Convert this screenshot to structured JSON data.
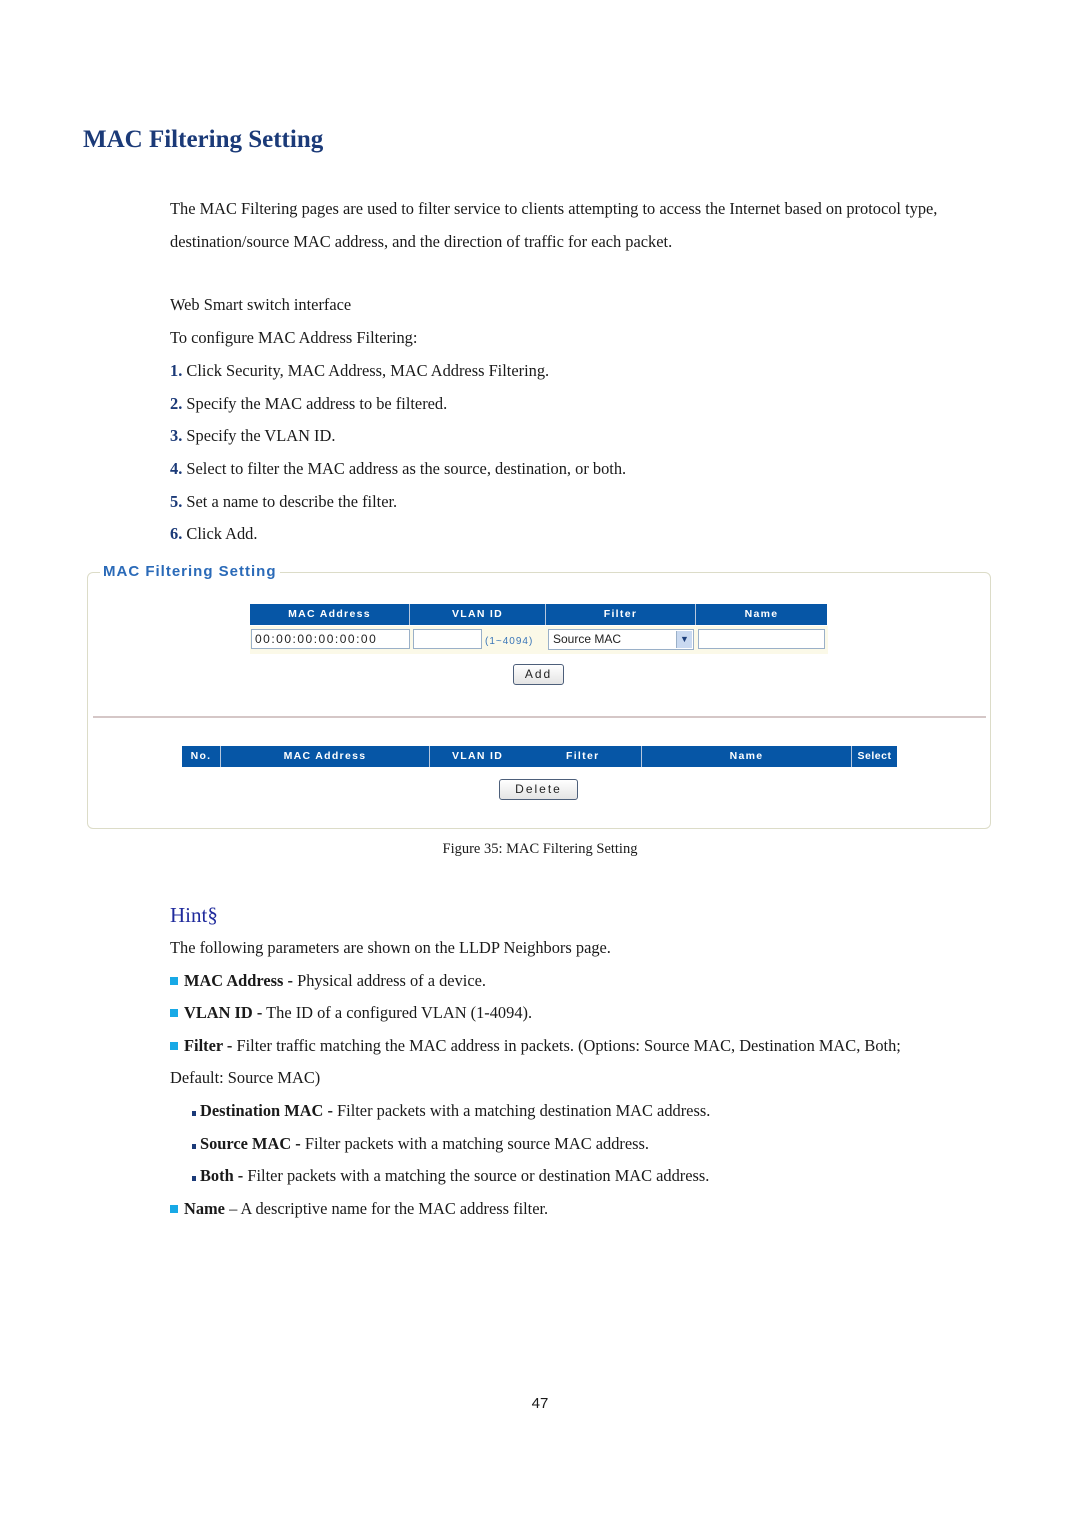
{
  "document": {
    "title": "MAC Filtering Setting",
    "intro": "The MAC Filtering pages are used to filter service to clients attempting to access the Internet based on protocol type, destination/source MAC address, and the direction of traffic for each packet.",
    "interface_label": "Web Smart switch interface",
    "configure_label": "To configure MAC Address Filtering:",
    "steps": [
      {
        "num": "1.",
        "text": "Click Security, MAC Address, MAC Address Filtering."
      },
      {
        "num": "2.",
        "text": "Specify the MAC address to be filtered."
      },
      {
        "num": "3.",
        "text": "Specify the VLAN ID."
      },
      {
        "num": "4.",
        "text": "Select to filter the MAC address as the source, destination, or both."
      },
      {
        "num": "5.",
        "text": "Set a name to describe the filter."
      },
      {
        "num": "6.",
        "text": "Click Add."
      }
    ],
    "figure_caption": "Figure 35: MAC Filtering Setting",
    "hint_heading": "Hint§",
    "hint_intro": "The following parameters are shown on the LLDP Neighbors page.",
    "params": [
      {
        "term": "MAC Address -",
        "desc": " Physical address of a device."
      },
      {
        "term": "VLAN ID -",
        "desc": " The ID of a configured VLAN (1-4094)."
      },
      {
        "term": "Filter -",
        "desc": " Filter traffic matching the MAC address in packets. (Options: Source MAC, Destination MAC, Both;",
        "desc_cont": "Default: Source MAC)"
      },
      {
        "term": "Name",
        "desc": " – A descriptive name for the MAC address filter."
      }
    ],
    "sub_params": [
      {
        "term": "Destination MAC -",
        "desc": " Filter packets with a matching destination MAC address."
      },
      {
        "term": "Source MAC -",
        "desc": " Filter packets with a matching source MAC address."
      },
      {
        "term": "Both -",
        "desc": " Filter packets with a matching the source or destination MAC address."
      }
    ],
    "page_number": "47"
  },
  "figure": {
    "panel_title": "MAC Filtering Setting",
    "add_form": {
      "headers": [
        "MAC Address",
        "VLAN ID",
        "Filter",
        "Name"
      ],
      "mac_value": "00:00:00:00:00:00",
      "vlan_value": "",
      "vlan_range": "(1~4094)",
      "filter_selected": "Source MAC",
      "name_value": "",
      "add_button": "Add"
    },
    "list_table": {
      "headers": [
        "No.",
        "MAC Address",
        "VLAN ID",
        "Filter",
        "Name",
        "Select"
      ],
      "rows": [],
      "delete_button": "Delete"
    },
    "colors": {
      "header_bg": "#0656a6",
      "panel_title": "#2a6ab8",
      "heading": "#1b3a78",
      "bullet": "#18a9e6"
    }
  }
}
